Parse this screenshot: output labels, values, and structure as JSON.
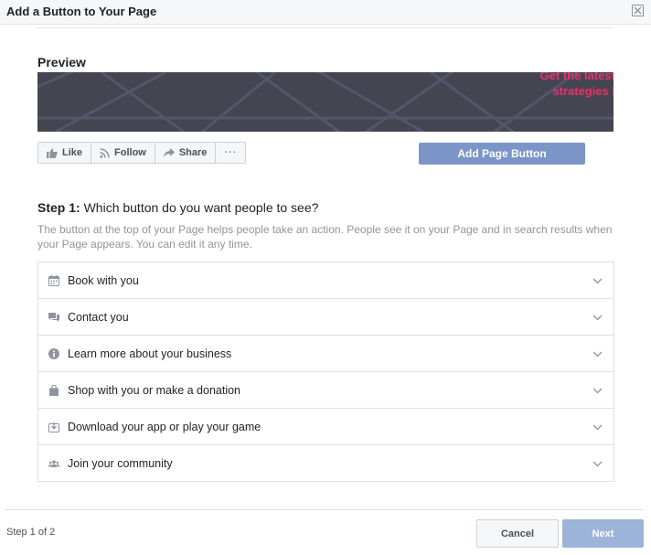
{
  "dialog": {
    "title": "Add a Button to Your Page"
  },
  "preview": {
    "title": "Preview",
    "cover_text_line1": "Get the latest",
    "cover_text_line2": "strategies i",
    "page_actions": [
      {
        "label": "Like",
        "icon": "thumbs-up-icon"
      },
      {
        "label": "Follow",
        "icon": "rss-icon"
      },
      {
        "label": "Share",
        "icon": "share-arrow-icon"
      },
      {
        "label": "···",
        "icon": "more-icon"
      }
    ],
    "add_page_button_label": "Add Page Button"
  },
  "step": {
    "heading_prefix": "Step 1:",
    "heading_text": " Which button do you want people to see?",
    "description": "The button at the top of your Page helps people take an action. People see it on your Page and in search results when your Page appears. You can edit it any time."
  },
  "options": [
    {
      "label": "Book with you",
      "icon": "calendar-icon"
    },
    {
      "label": "Contact you",
      "icon": "chat-bubbles-icon"
    },
    {
      "label": "Learn more about your business",
      "icon": "info-icon"
    },
    {
      "label": "Shop with you or make a donation",
      "icon": "shopping-bag-icon"
    },
    {
      "label": "Download your app or play your game",
      "icon": "download-icon"
    },
    {
      "label": "Join your community",
      "icon": "people-icon"
    }
  ],
  "footer": {
    "step_indicator": "Step 1 of 2",
    "cancel_label": "Cancel",
    "next_label": "Next"
  },
  "colors": {
    "primary_button": "#7b95c8",
    "next_disabled": "#9cb4d8",
    "cover_background": "#454552",
    "cover_text": "#e8336b"
  }
}
